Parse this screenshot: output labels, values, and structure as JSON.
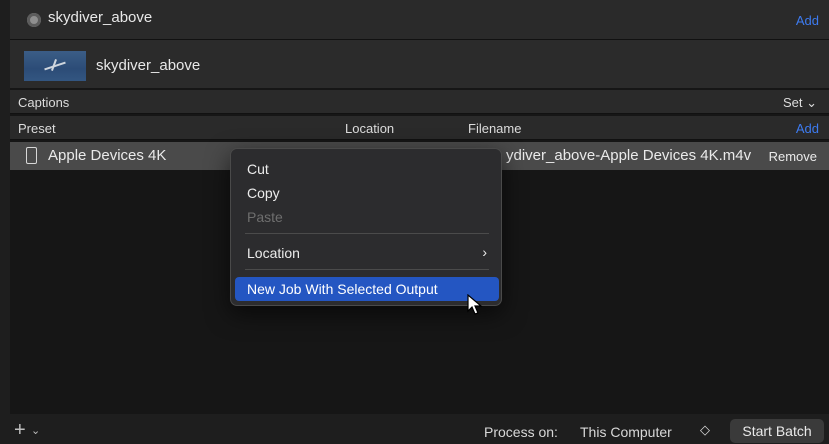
{
  "job": {
    "title": "skydiver_above",
    "add_label": "Add"
  },
  "source": {
    "name": "skydiver_above"
  },
  "captions": {
    "label": "Captions",
    "set_label": "Set ⌄"
  },
  "columns": {
    "preset": "Preset",
    "location": "Location",
    "filename": "Filename",
    "add_label": "Add"
  },
  "output": {
    "preset": "Apple Devices 4K",
    "filename": "ydiver_above-Apple Devices 4K.m4v",
    "remove_label": "Remove"
  },
  "context_menu": {
    "items": [
      {
        "label": "Cut",
        "enabled": true
      },
      {
        "label": "Copy",
        "enabled": true
      },
      {
        "label": "Paste",
        "enabled": false
      },
      {
        "label": "Location",
        "enabled": true,
        "submenu": true
      },
      {
        "label": "New Job With Selected Output",
        "enabled": true,
        "highlighted": true
      }
    ],
    "submenu_chevron": "›"
  },
  "bottom_bar": {
    "add_glyph": "+",
    "add_chevron": "⌄",
    "process_on_label": "Process on:",
    "process_on_value": "This Computer",
    "stepper_glyph": "◇",
    "start_batch_label": "Start Batch"
  },
  "colors": {
    "accent_blue": "#3d7bf0",
    "menu_highlight": "#2456c2",
    "selected_row": "#4a4a4a"
  }
}
